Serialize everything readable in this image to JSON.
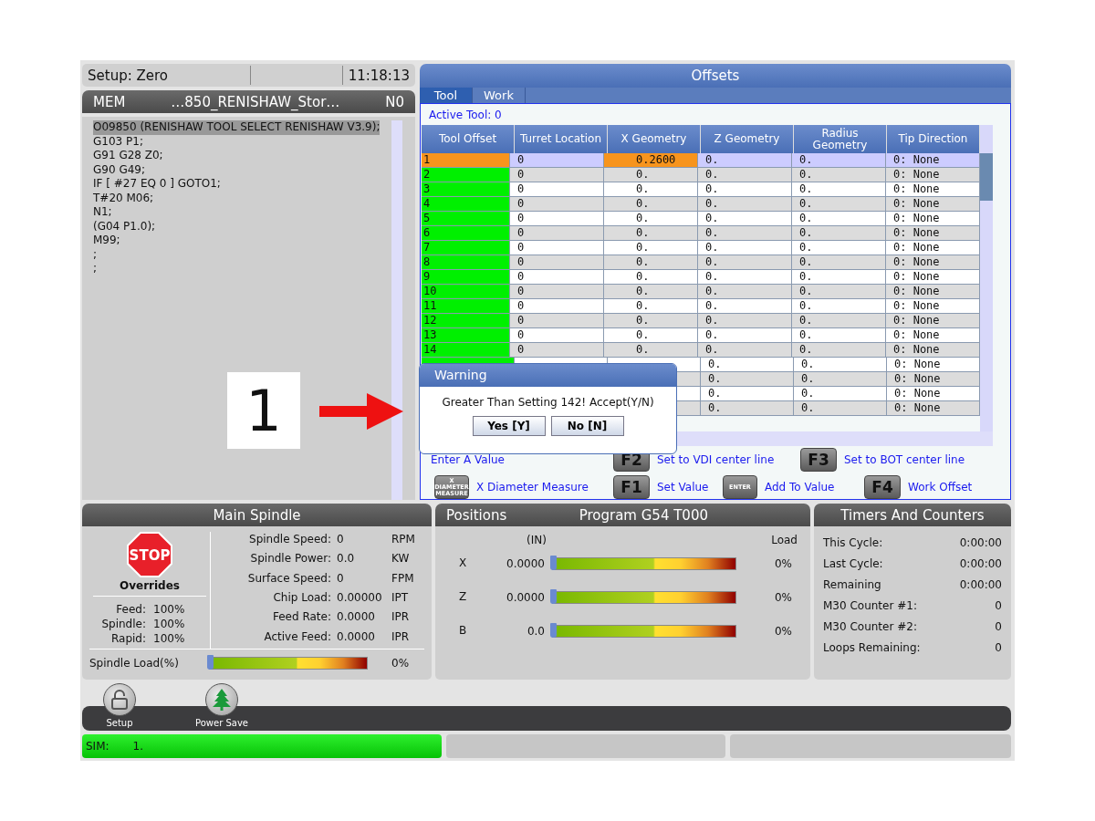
{
  "status": {
    "mode": "Setup: Zero",
    "time": "11:18:13"
  },
  "program": {
    "source": "MEM",
    "name": "…850_RENISHAW_Stor…",
    "line": "N0",
    "lines": [
      {
        "text": "O09850 (RENISHAW TOOL SELECT RENISHAW V3.9);",
        "selected": true
      },
      {
        "text": "G103 P1;",
        "selected": false
      },
      {
        "text": "G91 G28 Z0;",
        "selected": false
      },
      {
        "text": "G90 G49;",
        "selected": false
      },
      {
        "text": "IF [ #27 EQ 0 ] GOTO1;",
        "selected": false
      },
      {
        "text": "T#20 M06;",
        "selected": false
      },
      {
        "text": "N1;",
        "selected": false
      },
      {
        "text": "(G04 P1.0);",
        "selected": false
      },
      {
        "text": "M99;",
        "selected": false
      },
      {
        "text": ";",
        "selected": false
      },
      {
        "text": ";",
        "selected": false
      }
    ]
  },
  "callout": {
    "number": "1"
  },
  "offsets": {
    "title": "Offsets",
    "tabs": [
      {
        "label": "Tool",
        "selected": true
      },
      {
        "label": "Work",
        "selected": false
      }
    ],
    "active_tool": "Active Tool: 0",
    "columns": [
      "Tool Offset",
      "Turret Location",
      "X Geometry",
      "Z Geometry",
      "Radius Geometry",
      "Tip Direction"
    ],
    "rows": [
      {
        "selected": true,
        "cells": [
          {
            "text": "1",
            "active": true
          },
          {
            "text": "0",
            "active": false
          },
          {
            "text": "0.2600",
            "active": true
          },
          {
            "text": "0.",
            "active": false
          },
          {
            "text": "0.",
            "active": false
          },
          {
            "text": "0: None",
            "active": false
          }
        ]
      },
      {
        "selected": false,
        "cells": [
          {
            "text": "2",
            "active": false
          },
          {
            "text": "0",
            "active": false
          },
          {
            "text": "0.",
            "active": false
          },
          {
            "text": "0.",
            "active": false
          },
          {
            "text": "0.",
            "active": false
          },
          {
            "text": "0: None",
            "active": false
          }
        ]
      },
      {
        "selected": false,
        "cells": [
          {
            "text": "3",
            "active": false
          },
          {
            "text": "0",
            "active": false
          },
          {
            "text": "0.",
            "active": false
          },
          {
            "text": "0.",
            "active": false
          },
          {
            "text": "0.",
            "active": false
          },
          {
            "text": "0: None",
            "active": false
          }
        ]
      },
      {
        "selected": false,
        "cells": [
          {
            "text": "4",
            "active": false
          },
          {
            "text": "0",
            "active": false
          },
          {
            "text": "0.",
            "active": false
          },
          {
            "text": "0.",
            "active": false
          },
          {
            "text": "0.",
            "active": false
          },
          {
            "text": "0: None",
            "active": false
          }
        ]
      },
      {
        "selected": false,
        "cells": [
          {
            "text": "5",
            "active": false
          },
          {
            "text": "0",
            "active": false
          },
          {
            "text": "0.",
            "active": false
          },
          {
            "text": "0.",
            "active": false
          },
          {
            "text": "0.",
            "active": false
          },
          {
            "text": "0: None",
            "active": false
          }
        ]
      },
      {
        "selected": false,
        "cells": [
          {
            "text": "6",
            "active": false
          },
          {
            "text": "0",
            "active": false
          },
          {
            "text": "0.",
            "active": false
          },
          {
            "text": "0.",
            "active": false
          },
          {
            "text": "0.",
            "active": false
          },
          {
            "text": "0: None",
            "active": false
          }
        ]
      },
      {
        "selected": false,
        "cells": [
          {
            "text": "7",
            "active": false
          },
          {
            "text": "0",
            "active": false
          },
          {
            "text": "0.",
            "active": false
          },
          {
            "text": "0.",
            "active": false
          },
          {
            "text": "0.",
            "active": false
          },
          {
            "text": "0: None",
            "active": false
          }
        ]
      },
      {
        "selected": false,
        "cells": [
          {
            "text": "8",
            "active": false
          },
          {
            "text": "0",
            "active": false
          },
          {
            "text": "0.",
            "active": false
          },
          {
            "text": "0.",
            "active": false
          },
          {
            "text": "0.",
            "active": false
          },
          {
            "text": "0: None",
            "active": false
          }
        ]
      },
      {
        "selected": false,
        "cells": [
          {
            "text": "9",
            "active": false
          },
          {
            "text": "0",
            "active": false
          },
          {
            "text": "0.",
            "active": false
          },
          {
            "text": "0.",
            "active": false
          },
          {
            "text": "0.",
            "active": false
          },
          {
            "text": "0: None",
            "active": false
          }
        ]
      },
      {
        "selected": false,
        "cells": [
          {
            "text": "10",
            "active": false
          },
          {
            "text": "0",
            "active": false
          },
          {
            "text": "0.",
            "active": false
          },
          {
            "text": "0.",
            "active": false
          },
          {
            "text": "0.",
            "active": false
          },
          {
            "text": "0: None",
            "active": false
          }
        ]
      },
      {
        "selected": false,
        "cells": [
          {
            "text": "11",
            "active": false
          },
          {
            "text": "0",
            "active": false
          },
          {
            "text": "0.",
            "active": false
          },
          {
            "text": "0.",
            "active": false
          },
          {
            "text": "0.",
            "active": false
          },
          {
            "text": "0: None",
            "active": false
          }
        ]
      },
      {
        "selected": false,
        "cells": [
          {
            "text": "12",
            "active": false
          },
          {
            "text": "0",
            "active": false
          },
          {
            "text": "0.",
            "active": false
          },
          {
            "text": "0.",
            "active": false
          },
          {
            "text": "0.",
            "active": false
          },
          {
            "text": "0: None",
            "active": false
          }
        ]
      },
      {
        "selected": false,
        "cells": [
          {
            "text": "13",
            "active": false
          },
          {
            "text": "0",
            "active": false
          },
          {
            "text": "0.",
            "active": false
          },
          {
            "text": "0.",
            "active": false
          },
          {
            "text": "0.",
            "active": false
          },
          {
            "text": "0: None",
            "active": false
          }
        ]
      },
      {
        "selected": false,
        "cells": [
          {
            "text": "14",
            "active": false
          },
          {
            "text": "0",
            "active": false
          },
          {
            "text": "0.",
            "active": false
          },
          {
            "text": "0.",
            "active": false
          },
          {
            "text": "0.",
            "active": false
          },
          {
            "text": "0: None",
            "active": false
          }
        ]
      },
      {
        "selected": false,
        "cells": [
          {
            "text": "0.",
            "active": false
          },
          {
            "text": "0.",
            "active": false
          },
          {
            "text": "0: None",
            "active": false
          }
        ]
      },
      {
        "selected": false,
        "cells": [
          {
            "text": "0.",
            "active": false
          },
          {
            "text": "0.",
            "active": false
          },
          {
            "text": "0: None",
            "active": false
          }
        ]
      },
      {
        "selected": false,
        "cells": [
          {
            "text": "0.",
            "active": false
          },
          {
            "text": "0.",
            "active": false
          },
          {
            "text": "0: None",
            "active": false
          }
        ]
      },
      {
        "selected": false,
        "cells": [
          {
            "text": "0.",
            "active": false
          },
          {
            "text": "0.",
            "active": false
          },
          {
            "text": "0: None",
            "active": false
          }
        ]
      }
    ],
    "legend": [
      [
        {
          "label": "Enter A Value"
        },
        {
          "key": "F2",
          "label": "Set to VDI center line"
        },
        {
          "key": "F3",
          "label": "Set to BOT center line"
        }
      ],
      [
        {
          "key": "X DIAMETER MEASURE",
          "kind": "small",
          "label": "X Diameter Measure"
        },
        {
          "key": "F1",
          "label": "Set Value"
        },
        {
          "key": "ENTER",
          "kind": "small",
          "label": "Add To Value"
        },
        {
          "key": "F4",
          "label": "Work Offset"
        }
      ]
    ]
  },
  "dialog": {
    "title": "Warning",
    "message": "Greater Than Setting 142! Accept(Y/N)",
    "buttons": [
      "Yes [Y]",
      "No [N]"
    ]
  },
  "spindle": {
    "title": "Main Spindle",
    "stop": "STOP",
    "overrides_title": "Overrides",
    "overrides": [
      {
        "label": "Feed:",
        "value": "100%"
      },
      {
        "label": "Spindle:",
        "value": "100%"
      },
      {
        "label": "Rapid:",
        "value": "100%"
      }
    ],
    "stats": [
      {
        "label": "Spindle Speed:",
        "value": "0",
        "unit": "RPM"
      },
      {
        "label": "Spindle Power:",
        "value": "0.0",
        "unit": "KW"
      },
      {
        "label": "Surface Speed:",
        "value": "0",
        "unit": "FPM"
      },
      {
        "label": "Chip Load:",
        "value": "0.00000",
        "unit": "IPT"
      },
      {
        "label": "Feed Rate:",
        "value": "0.0000",
        "unit": "IPR"
      },
      {
        "label": "Active Feed:",
        "value": "0.0000",
        "unit": "IPR"
      }
    ],
    "load": {
      "label": "Spindle Load(%)",
      "level": 0,
      "reading": "0%"
    }
  },
  "positions": {
    "title": "Positions",
    "program": "Program G54 T000",
    "units": "(IN)",
    "load_heading": "Load",
    "axes": [
      {
        "axis": "X",
        "value": "0.0000",
        "level": 0,
        "reading": "0%"
      },
      {
        "axis": "Z",
        "value": "0.0000",
        "level": 0,
        "reading": "0%"
      },
      {
        "axis": "B",
        "value": "0.0",
        "level": 0,
        "reading": "0%"
      }
    ]
  },
  "timers": {
    "title": "Timers And Counters",
    "rows": [
      {
        "label": "This Cycle:",
        "value": "0:00:00"
      },
      {
        "label": "Last Cycle:",
        "value": "0:00:00"
      },
      {
        "label": "Remaining",
        "value": "0:00:00"
      },
      {
        "label": "M30 Counter #1:",
        "value": "0"
      },
      {
        "label": "M30 Counter #2:",
        "value": "0"
      },
      {
        "label": "Loops Remaining:",
        "value": "0"
      }
    ]
  },
  "toolbar": [
    {
      "kind": "padlock",
      "label": "Setup"
    },
    {
      "kind": "tree",
      "label": "Power Save"
    }
  ],
  "status_bar": {
    "label": "SIM:",
    "value": "1."
  }
}
